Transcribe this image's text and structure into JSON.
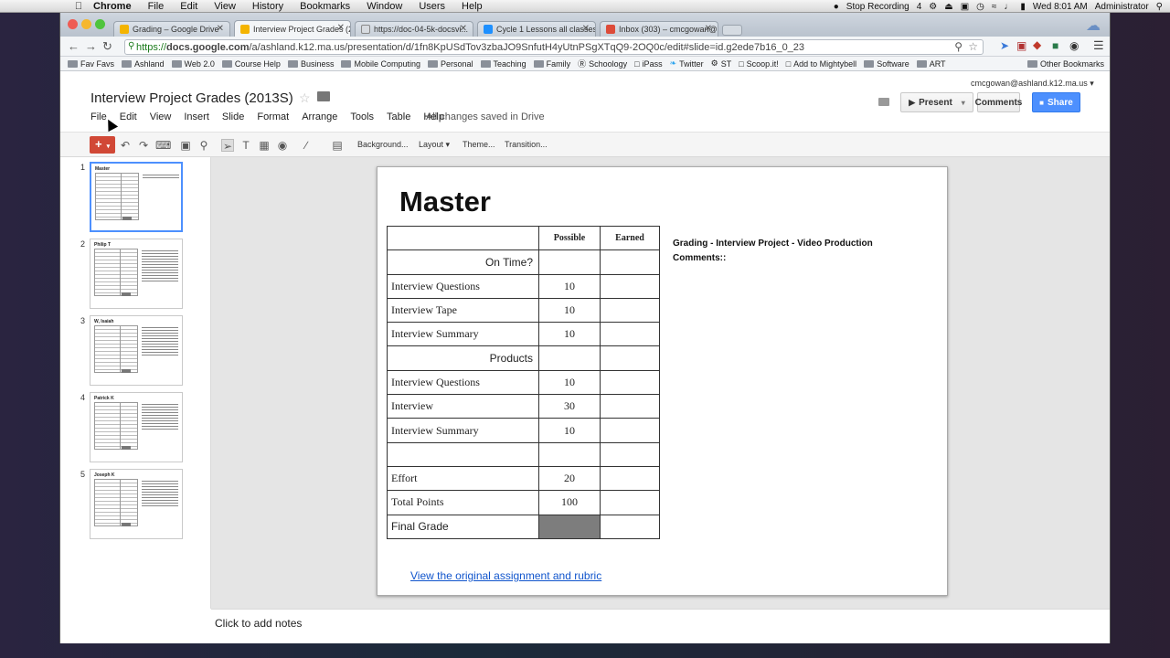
{
  "mac_menu": {
    "app": "Chrome",
    "items": [
      "File",
      "Edit",
      "View",
      "History",
      "Bookmarks",
      "Window",
      "Users",
      "Help"
    ],
    "status": {
      "recording": "Stop Recording",
      "clock": "Wed 8:01 AM",
      "user": "Administrator",
      "badge": "4"
    }
  },
  "browser": {
    "tabs": [
      {
        "label": "Grading – Google Drive",
        "color": "#f4b400"
      },
      {
        "label": "Interview Project Grades (2...",
        "color": "#f4b400"
      },
      {
        "label": "https://doc-04-5k-docsvi...",
        "color": "#4d90fe"
      },
      {
        "label": "Cycle 1 Lessons all classes",
        "color": "#1e90ff"
      },
      {
        "label": "Inbox (303) – cmcgowan@...",
        "color": "#dd4b39"
      }
    ],
    "url_prefix": "https://",
    "url_domain": "docs.google.com",
    "url_rest": "/a/ashland.k12.ma.us/presentation/d/1fn8KpUSdTov3zbaJO9SnfutH4yUtnPSgXTqQ9-2OQ0c/edit#slide=id.g2ede7b16_0_23",
    "bookmarks": [
      "Fav Favs",
      "Ashland",
      "Web 2.0",
      "Course Help",
      "Business",
      "Mobile Computing",
      "Personal",
      "Teaching",
      "Family",
      "Schoology",
      "iPass",
      "Twitter",
      "ST",
      "Scoop.it!",
      "Add to Mightybell",
      "Software",
      "ART"
    ],
    "other_bookmarks": "Other Bookmarks"
  },
  "doc": {
    "title": "Interview Project Grades (2013S)",
    "account": "cmcgowan@ashland.k12.ma.us",
    "menus": [
      "File",
      "Edit",
      "View",
      "Insert",
      "Slide",
      "Format",
      "Arrange",
      "Tools",
      "Table",
      "Help"
    ],
    "saved_status": "All changes saved in Drive",
    "present": "Present",
    "comments": "Comments",
    "share": "Share",
    "toolbar_text": {
      "background": "Background...",
      "layout": "Layout",
      "theme": "Theme...",
      "transition": "Transition..."
    }
  },
  "thumbnails": [
    {
      "num": "1",
      "title": "Master",
      "selected": true
    },
    {
      "num": "2",
      "title": "Philip T",
      "selected": false
    },
    {
      "num": "3",
      "title": "W, Isaiah",
      "selected": false
    },
    {
      "num": "4",
      "title": "Patrick K",
      "selected": false
    },
    {
      "num": "5",
      "title": "Joseph K",
      "selected": false
    }
  ],
  "slide": {
    "title": "Master",
    "table_header": [
      "",
      "Possible",
      "Earned"
    ],
    "rows": [
      {
        "label": "On Time?",
        "possible": "",
        "earned": "",
        "style": "ra"
      },
      {
        "label": "Interview Questions",
        "possible": "10",
        "earned": "",
        "style": ""
      },
      {
        "label": "Interview Tape",
        "possible": "10",
        "earned": "",
        "style": ""
      },
      {
        "label": "Interview Summary",
        "possible": "10",
        "earned": "",
        "style": ""
      },
      {
        "label": "Products",
        "possible": "",
        "earned": "",
        "style": "ra"
      },
      {
        "label": "Interview Questions",
        "possible": "10",
        "earned": "",
        "style": ""
      },
      {
        "label": "Interview",
        "possible": "30",
        "earned": "",
        "style": ""
      },
      {
        "label": "Interview Summary",
        "possible": "10",
        "earned": "",
        "style": ""
      },
      {
        "label": "",
        "possible": "",
        "earned": "",
        "style": ""
      },
      {
        "label": "Effort",
        "possible": "20",
        "earned": "",
        "style": ""
      },
      {
        "label": "Total Points",
        "possible": "100",
        "earned": "",
        "style": ""
      },
      {
        "label": "Final Grade",
        "possible": "",
        "earned": "",
        "style": "final"
      }
    ],
    "side_line1": "Grading - Interview Project - Video Production",
    "side_line2": "Comments::",
    "link": "View the original assignment and rubric"
  },
  "notes_placeholder": "Click to add notes"
}
